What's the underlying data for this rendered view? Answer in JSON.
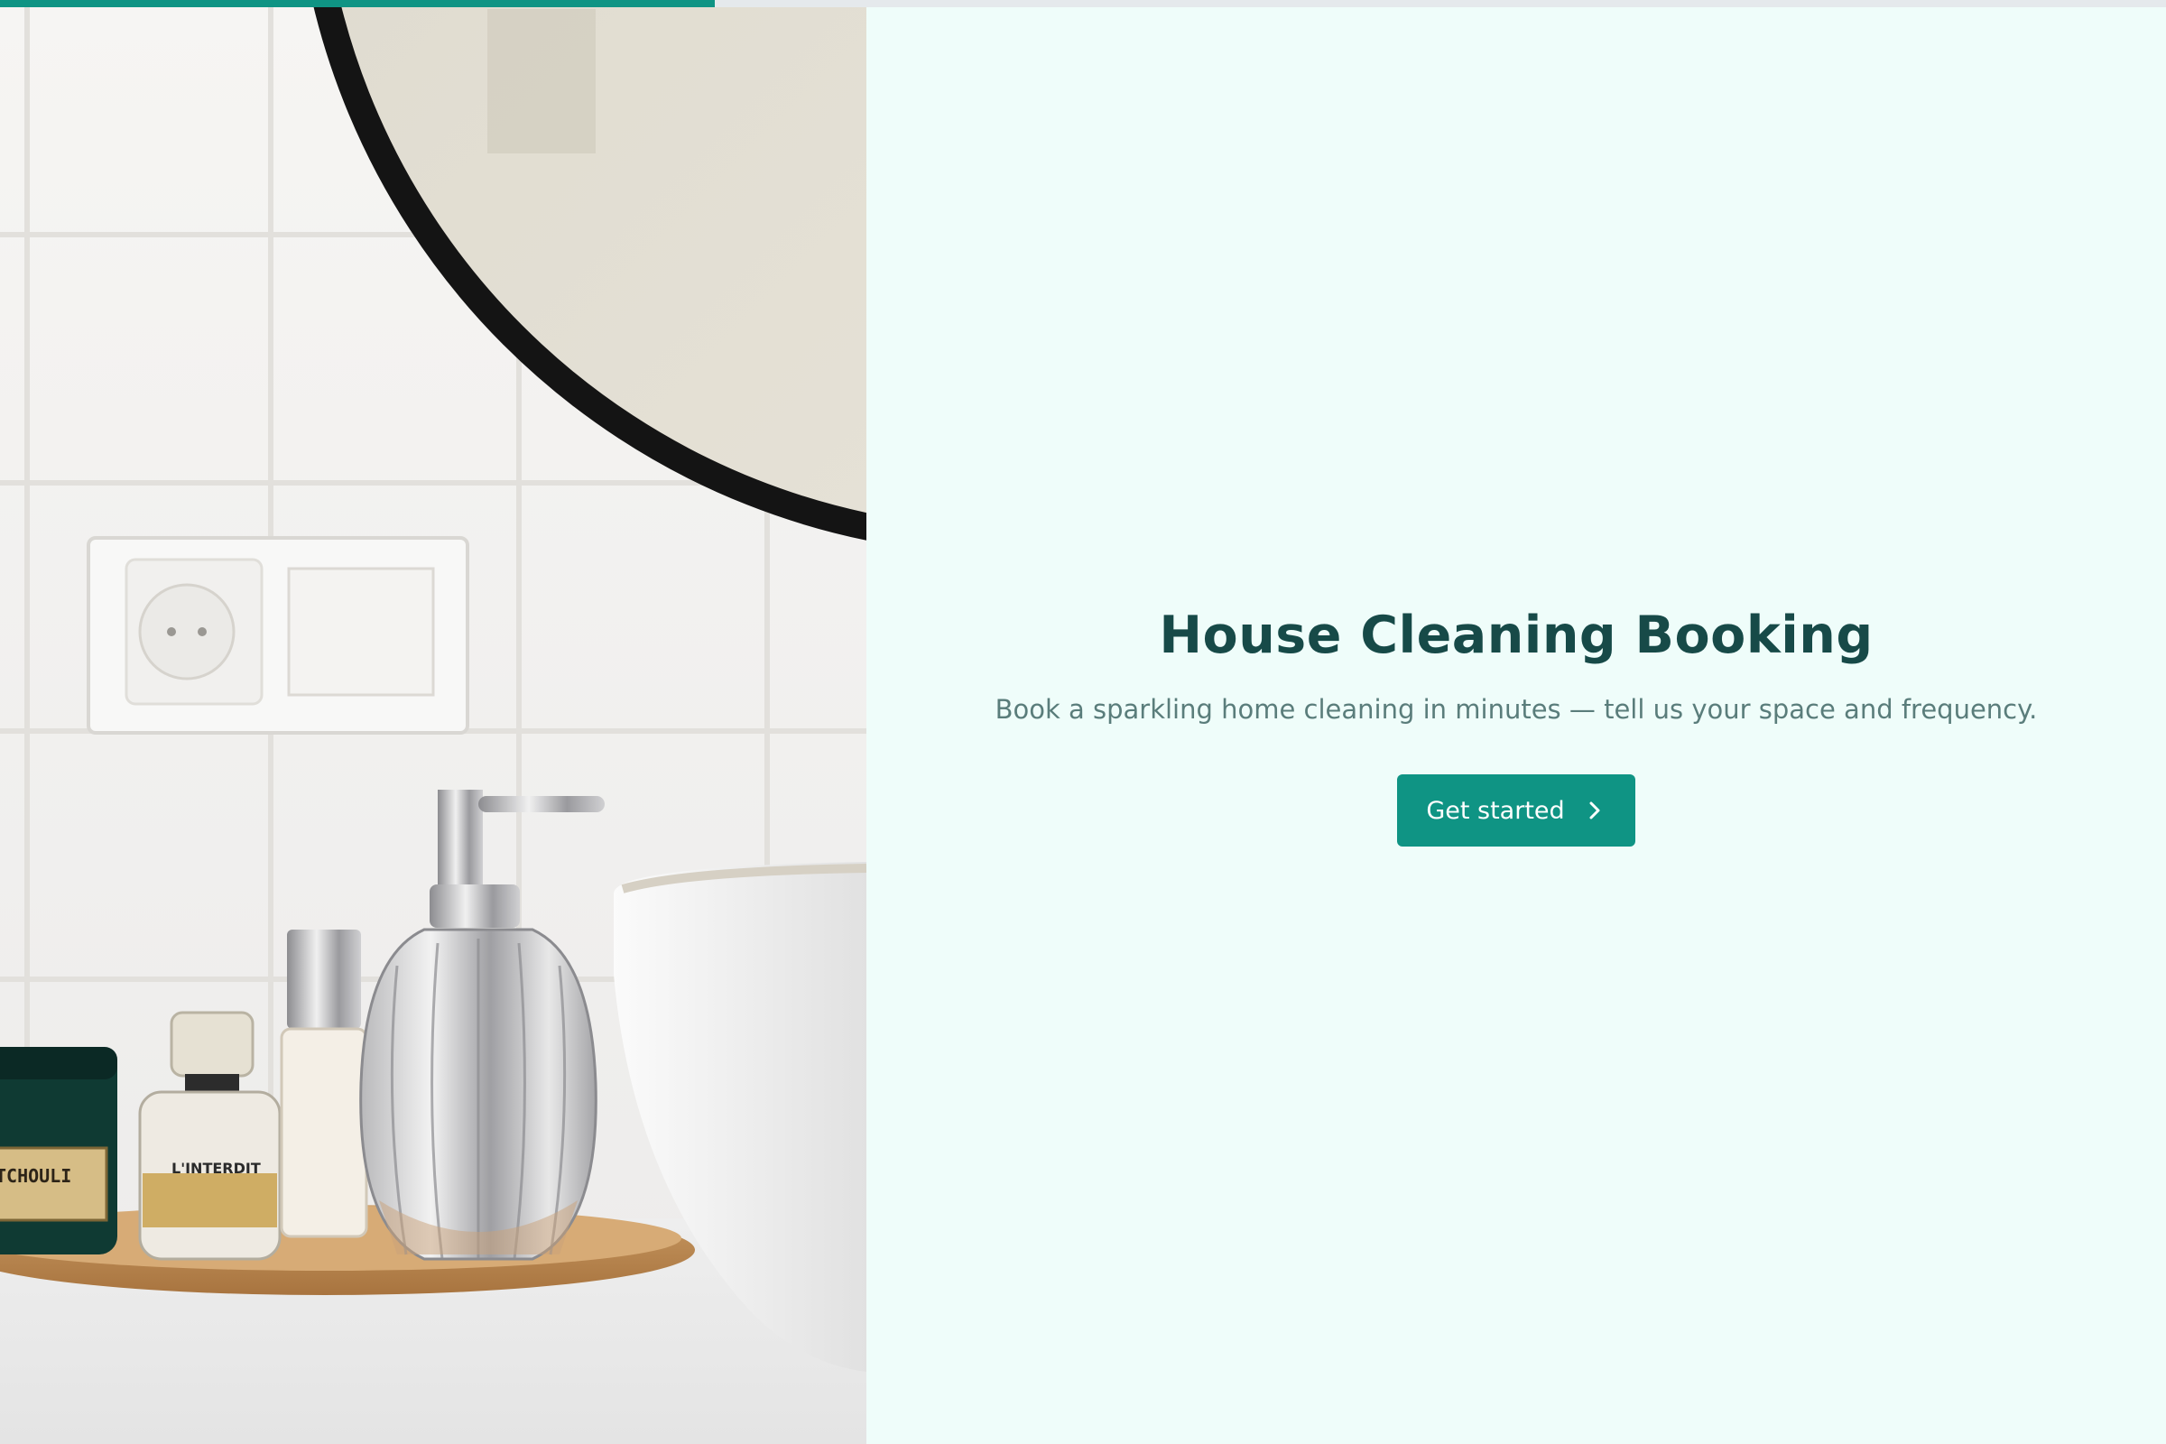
{
  "progress": {
    "value": 0.33
  },
  "hero": {
    "jar_label": "TCHOULI",
    "perfume_label": "L'INTERDIT"
  },
  "content": {
    "title": "House Cleaning Booking",
    "subtitle": "Book a sparkling home cleaning in minutes — tell us your space and frequency.",
    "cta_label": "Get started",
    "cta_icon": "chevron-right-icon"
  },
  "colors": {
    "accent": "#0f9484",
    "title": "#174a48",
    "subtitle": "#5a7d7b",
    "background": "#effdfa"
  }
}
